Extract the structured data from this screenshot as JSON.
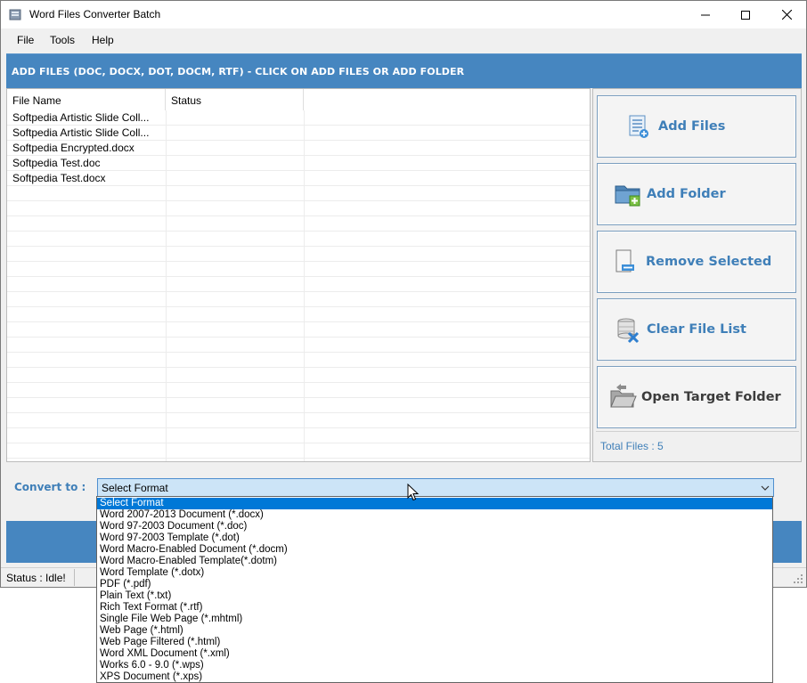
{
  "window": {
    "title": "Word Files Converter Batch"
  },
  "menu": [
    "File",
    "Tools",
    "Help"
  ],
  "header": {
    "text": "ADD FILES (DOC, DOCX, DOT, DOCM, RTF) - CLICK ON ADD FILES OR ADD FOLDER"
  },
  "filelist": {
    "columns": [
      "File Name",
      "Status"
    ],
    "rows": [
      {
        "name": "Softpedia Artistic Slide Coll...",
        "status": ""
      },
      {
        "name": "Softpedia Artistic Slide Coll...",
        "status": ""
      },
      {
        "name": "Softpedia Encrypted.docx",
        "status": ""
      },
      {
        "name": "Softpedia Test.doc",
        "status": ""
      },
      {
        "name": "Softpedia Test.docx",
        "status": ""
      }
    ]
  },
  "actions": {
    "add_files": "Add Files",
    "add_folder": "Add Folder",
    "remove_selected": "Remove Selected",
    "clear_list": "Clear File List",
    "open_target": "Open Target Folder"
  },
  "total_files": "Total Files : 5",
  "convert": {
    "label": "Convert to :",
    "selected": "Select Format",
    "options": [
      "Select Format",
      "Word 2007-2013 Document (*.docx)",
      "Word 97-2003 Document (*.doc)",
      "Word 97-2003 Template (*.dot)",
      "Word Macro-Enabled Document (*.docm)",
      "Word Macro-Enabled Template(*.dotm)",
      "Word Template (*.dotx)",
      "PDF (*.pdf)",
      "Plain Text (*.txt)",
      "Rich Text Format (*.rtf)",
      "Single File Web Page (*.mhtml)",
      "Web Page (*.html)",
      "Web Page Filtered (*.html)",
      "Word XML Document (*.xml)",
      "Works 6.0 - 9.0 (*.wps)",
      "XPS Document (*.xps)"
    ]
  },
  "status": {
    "text": "Status  :  Idle!"
  },
  "colors": {
    "accent_blue": "#4686c0",
    "label_blue": "#3f7fb8",
    "highlight": "#0078d7"
  }
}
